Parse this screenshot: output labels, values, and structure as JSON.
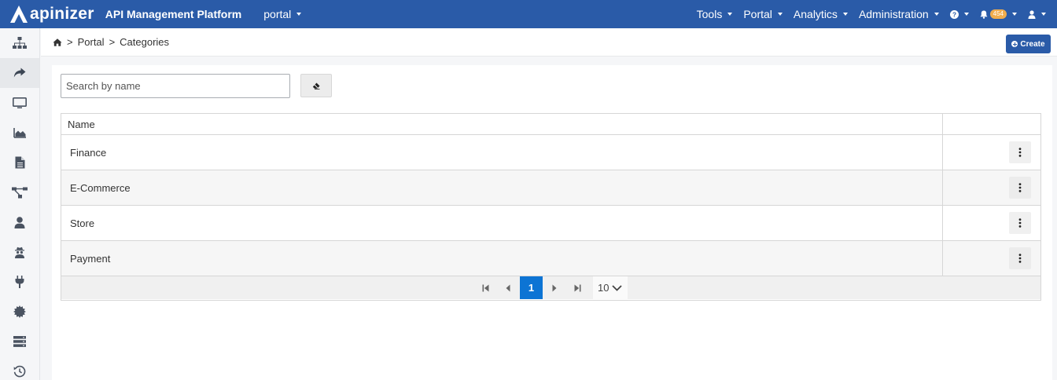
{
  "navbar": {
    "brand_name": "apinizer",
    "brand_subtitle": "API Management Platform",
    "context": "portal",
    "menus": [
      "Tools",
      "Portal",
      "Analytics",
      "Administration"
    ],
    "notification_count": "454",
    "icons": [
      "help-icon",
      "bell-icon",
      "user-icon"
    ],
    "color": "#2a5ba8"
  },
  "sidebar": {
    "items": [
      {
        "icon": "sitemap-icon"
      },
      {
        "icon": "share-arrow-icon",
        "active": true
      },
      {
        "icon": "monitor-icon"
      },
      {
        "icon": "area-chart-icon"
      },
      {
        "icon": "document-icon"
      },
      {
        "icon": "flow-icon"
      },
      {
        "icon": "user-icon"
      },
      {
        "icon": "spy-icon"
      },
      {
        "icon": "plug-icon"
      },
      {
        "icon": "cog-burst-icon"
      },
      {
        "icon": "server-icon"
      },
      {
        "icon": "history-icon"
      }
    ]
  },
  "breadcrumb": {
    "home_icon": "home-icon",
    "items": [
      "Portal",
      "Categories"
    ]
  },
  "toolbar": {
    "create_label": "Create"
  },
  "search": {
    "placeholder": "Search by name",
    "value": ""
  },
  "table": {
    "columns": [
      "Name",
      ""
    ],
    "rows": [
      {
        "name": "Finance"
      },
      {
        "name": "E-Commerce"
      },
      {
        "name": "Store"
      },
      {
        "name": "Payment"
      }
    ]
  },
  "pagination": {
    "current_page": "1",
    "page_size": "10",
    "accent": "#0d74d4"
  }
}
